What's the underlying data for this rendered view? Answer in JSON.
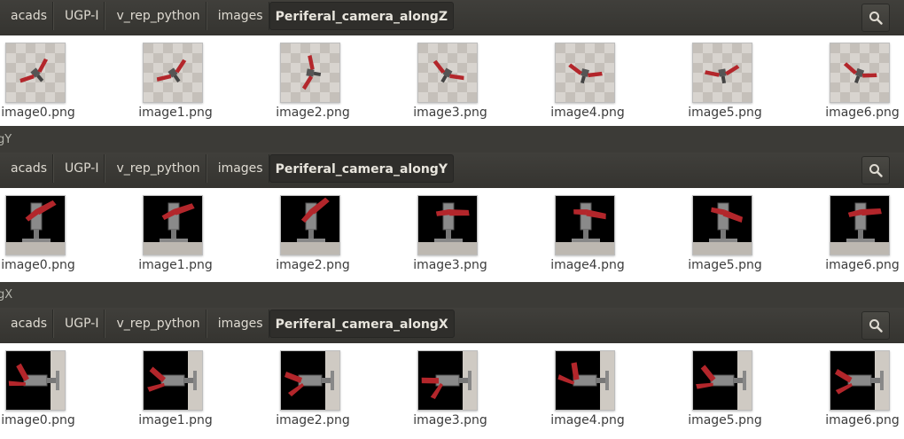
{
  "window1": {
    "breadcrumbs": [
      "acads",
      "UGP-I",
      "v_rep_python",
      "images"
    ],
    "current_folder": "Periferal_camera_alongZ",
    "files": [
      "image0.png",
      "image1.png",
      "image2.png",
      "image3.png",
      "image4.png",
      "image5.png",
      "image6.png"
    ]
  },
  "window2": {
    "title_fragment": "gY",
    "breadcrumbs": [
      "acads",
      "UGP-I",
      "v_rep_python",
      "images"
    ],
    "current_folder": "Periferal_camera_alongY",
    "files": [
      "image0.png",
      "image1.png",
      "image2.png",
      "image3.png",
      "image4.png",
      "image5.png",
      "image6.png"
    ]
  },
  "window3": {
    "title_fragment": "gX",
    "breadcrumbs": [
      "acads",
      "UGP-I",
      "v_rep_python",
      "images"
    ],
    "current_folder": "Periferal_camera_alongX",
    "files": [
      "image0.png",
      "image1.png",
      "image2.png",
      "image3.png",
      "image4.png",
      "image5.png",
      "image6.png"
    ]
  },
  "icons": {
    "search": "search-icon"
  },
  "colors": {
    "toolbar": "#3c3b37",
    "content": "#ffffff",
    "robot_red": "#b3262b",
    "robot_gray": "#8a8a8a"
  }
}
